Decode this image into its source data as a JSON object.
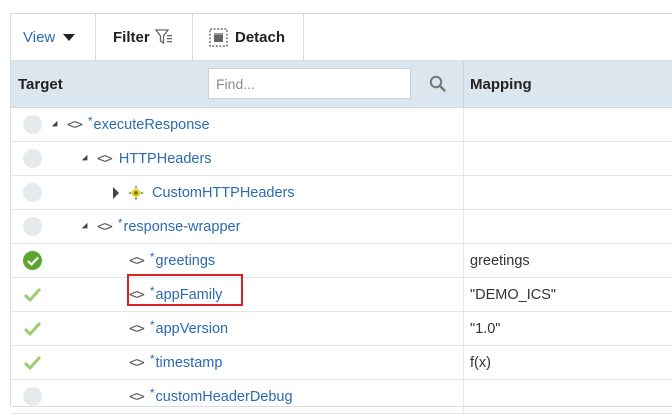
{
  "toolbar": {
    "view_label": "View",
    "filter_label": "Filter",
    "detach_label": "Detach"
  },
  "header": {
    "target_label": "Target",
    "find_placeholder": "Find...",
    "mapping_label": "Mapping"
  },
  "rows": [
    {
      "status": "empty",
      "toggle": "expanded",
      "icon": "code-icon",
      "required": "*",
      "name": "executeResponse",
      "mapping": ""
    },
    {
      "status": "empty",
      "toggle": "expanded",
      "icon": "code-icon",
      "required": "",
      "name": "HTTPHeaders",
      "mapping": ""
    },
    {
      "status": "empty",
      "toggle": "collapsed",
      "icon": "choice-icon",
      "required": "",
      "name": "CustomHTTPHeaders",
      "mapping": ""
    },
    {
      "status": "empty",
      "toggle": "expanded",
      "icon": "code-icon",
      "required": "*",
      "name": "response-wrapper",
      "mapping": ""
    },
    {
      "status": "mapped-circle",
      "toggle": "none",
      "icon": "code-icon",
      "required": "*",
      "name": "greetings",
      "mapping": "greetings"
    },
    {
      "status": "mapped-check",
      "toggle": "none",
      "icon": "code-icon",
      "required": "*",
      "name": "appFamily",
      "mapping": "\"DEMO_ICS\""
    },
    {
      "status": "mapped-check",
      "toggle": "none",
      "icon": "code-icon",
      "required": "*",
      "name": "appVersion",
      "mapping": "\"1.0\""
    },
    {
      "status": "mapped-check",
      "toggle": "none",
      "icon": "code-icon",
      "required": "*",
      "name": "timestamp",
      "mapping": "f(x)"
    },
    {
      "status": "empty",
      "toggle": "none",
      "icon": "code-icon",
      "required": "*",
      "name": "customHeaderDebug",
      "mapping": ""
    }
  ],
  "colors": {
    "link": "#2a6bb3",
    "header_bg": "#dce6ee",
    "ok_green": "#5aa630",
    "check_light": "#9ccc72",
    "highlight_red": "#d9211f"
  }
}
